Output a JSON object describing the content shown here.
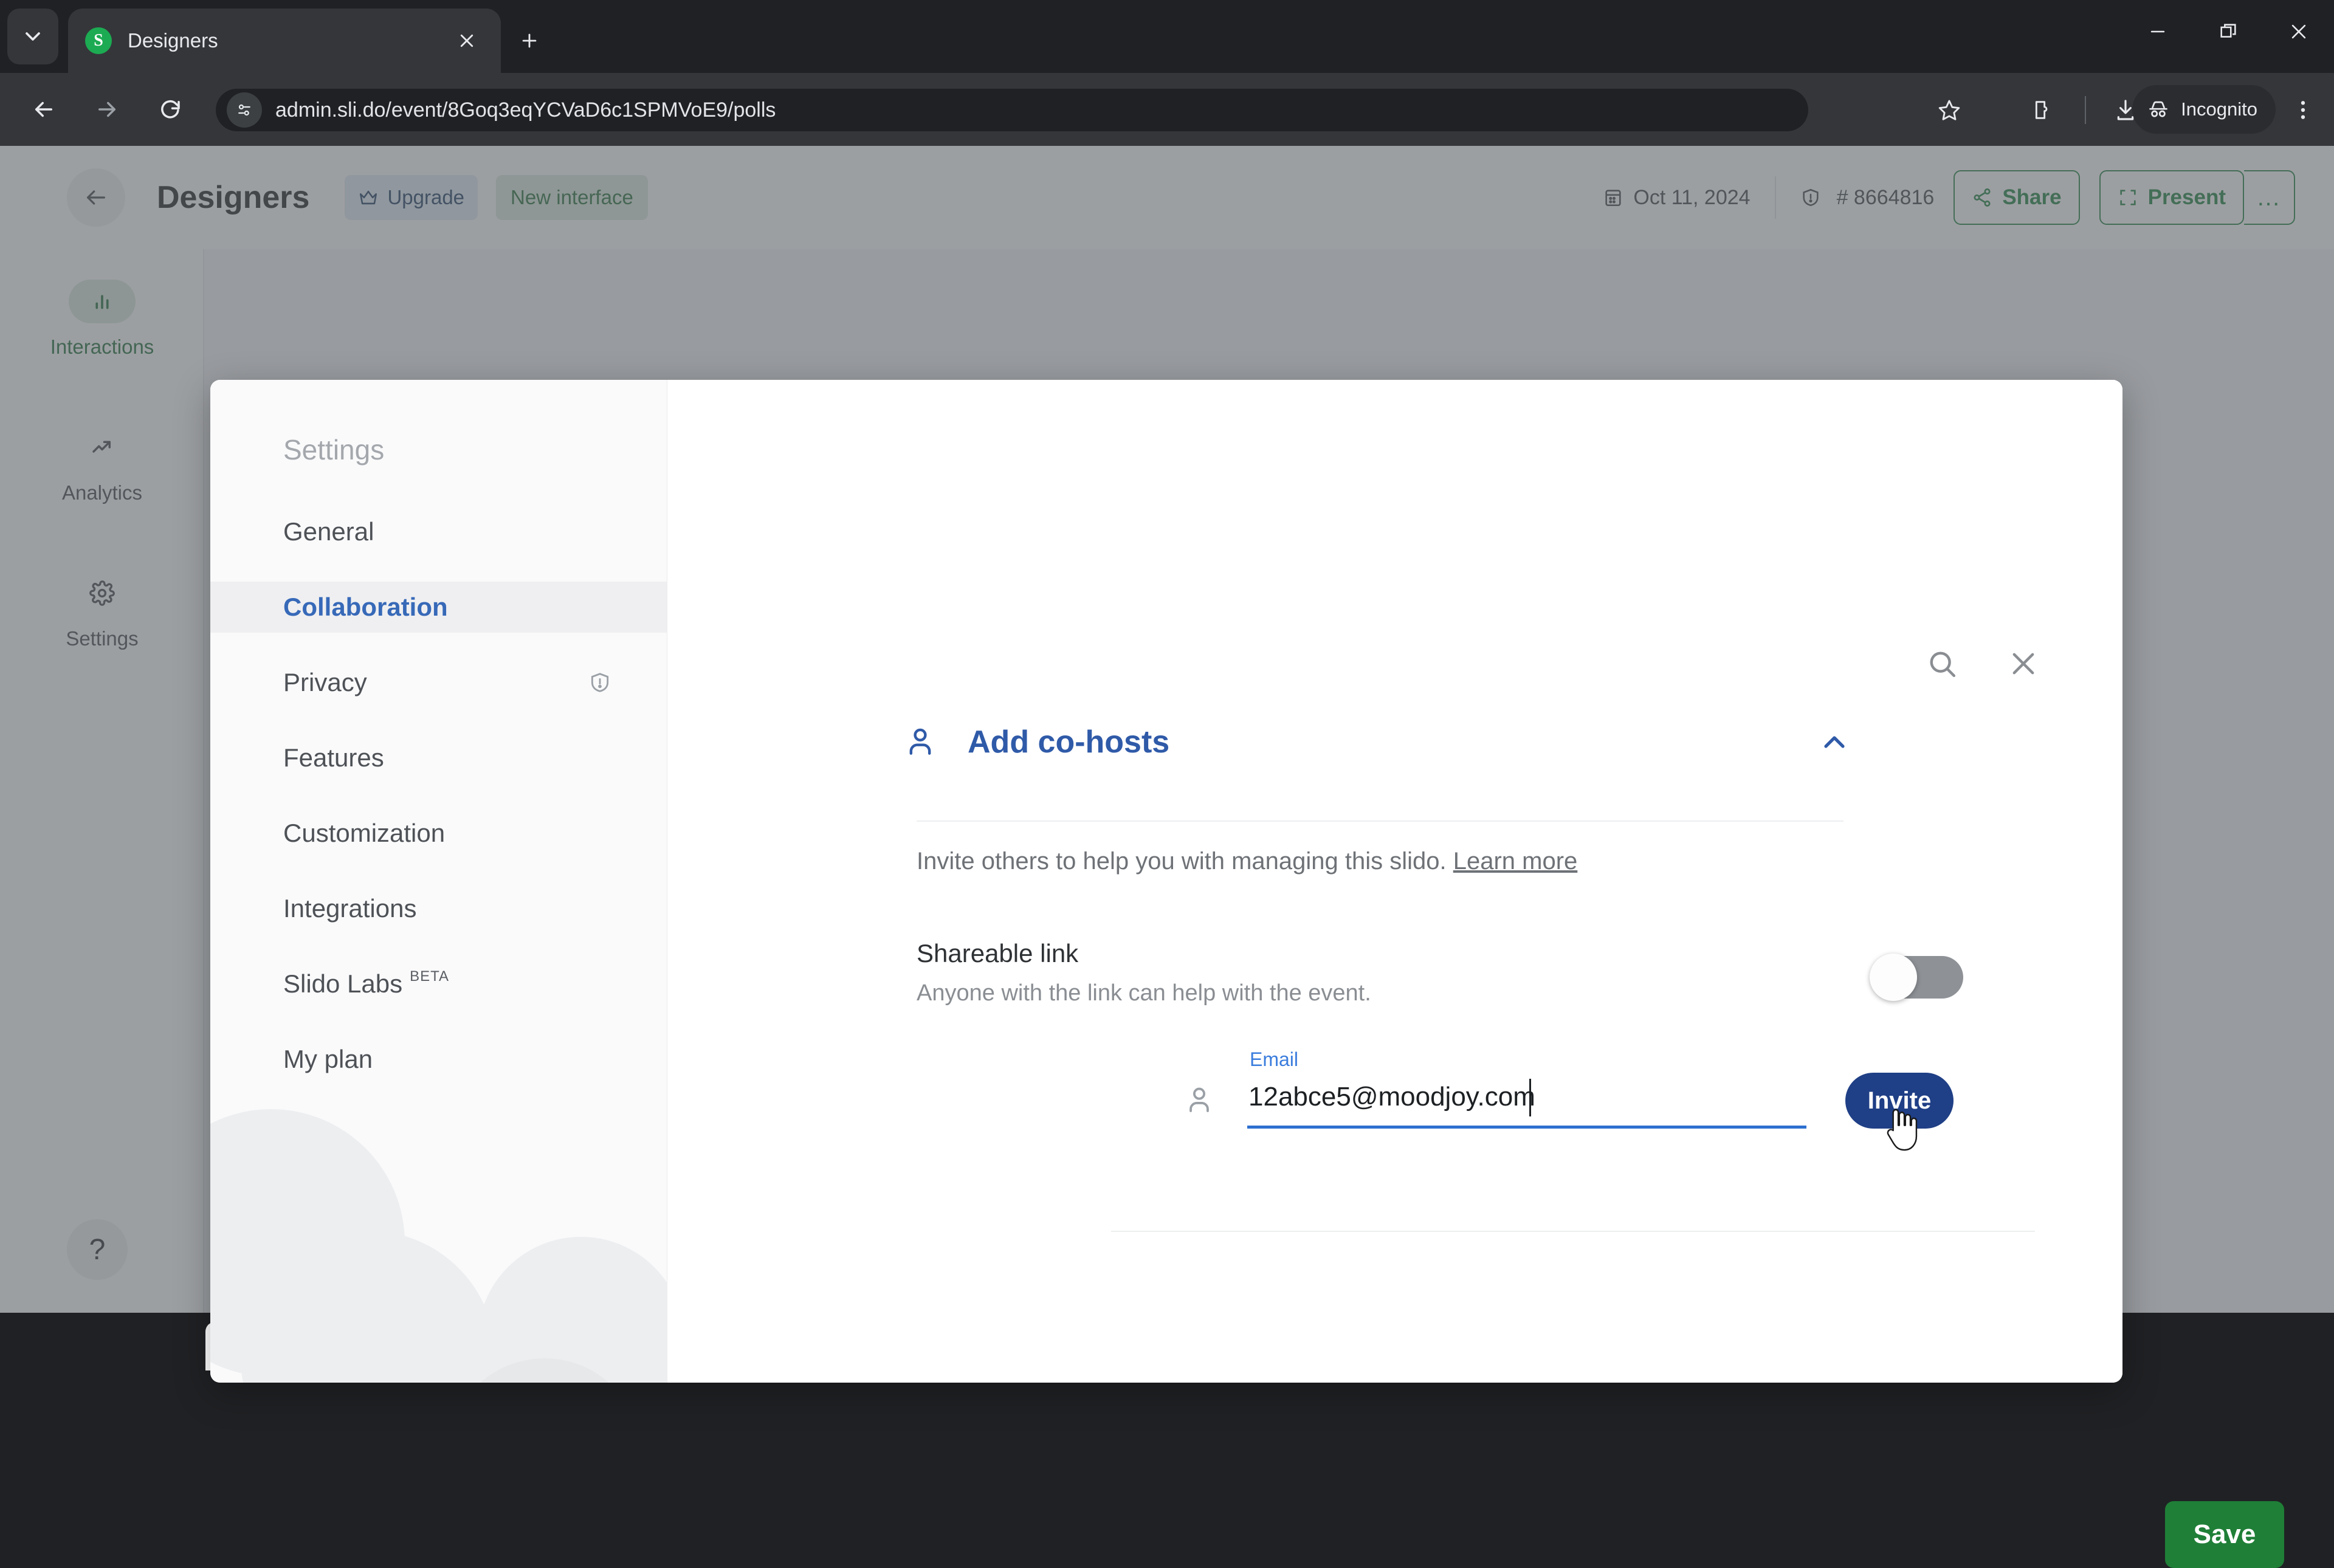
{
  "browser": {
    "tab": {
      "title": "Designers",
      "favicon_letter": "S",
      "favicon_color": "#1cab52"
    },
    "tab_search_icon": "chevron-down-icon",
    "new_tab_icon": "plus-icon",
    "window_controls": [
      "minimize-icon",
      "restore-icon",
      "close-icon"
    ],
    "nav": {
      "back_icon": "arrow-left-icon",
      "forward_icon": "arrow-right-icon",
      "reload_icon": "reload-icon"
    },
    "omnibox": {
      "site_info_icon": "page-settings-icon",
      "url": "admin.sli.do/event/8Goq3eqYCVaD6c1SPMVoE9/polls"
    },
    "actions": {
      "bookmark_icon": "star-icon",
      "extensions_icon": "extensions-icon",
      "download_icon": "download-icon",
      "incognito_icon": "incognito-icon",
      "incognito_label": "Incognito",
      "menu_icon": "kebab-menu-icon"
    }
  },
  "app_header": {
    "back_icon": "arrow-left-icon",
    "title": "Designers",
    "upgrade": {
      "icon": "crown-icon",
      "label": "Upgrade"
    },
    "new_interface_label": "New interface",
    "date": {
      "icon": "calendar-icon",
      "label": "Oct 11, 2024"
    },
    "event_code": {
      "icon": "shield-alert-icon",
      "label": "# 8664816"
    },
    "share": {
      "icon": "share-icon",
      "label": "Share"
    },
    "present": {
      "icon": "present-icon",
      "label": "Present"
    },
    "more_label": "…"
  },
  "left_rail": {
    "items": [
      {
        "icon": "bar-chart-icon",
        "label": "Interactions",
        "active": true
      },
      {
        "icon": "trending-up-icon",
        "label": "Analytics",
        "active": false
      },
      {
        "icon": "gear-icon",
        "label": "Settings",
        "active": false
      }
    ],
    "help_label": "?"
  },
  "modal": {
    "sidebar": {
      "heading": "Settings",
      "items": [
        {
          "label": "General",
          "active": false,
          "badge": "",
          "warn": false
        },
        {
          "label": "Collaboration",
          "active": true,
          "badge": "",
          "warn": false
        },
        {
          "label": "Privacy",
          "active": false,
          "badge": "",
          "warn": true
        },
        {
          "label": "Features",
          "active": false,
          "badge": "",
          "warn": false
        },
        {
          "label": "Customization",
          "active": false,
          "badge": "",
          "warn": false
        },
        {
          "label": "Integrations",
          "active": false,
          "badge": "",
          "warn": false
        },
        {
          "label": "Slido Labs",
          "active": false,
          "badge": "BETA",
          "warn": false
        },
        {
          "label": "My plan",
          "active": false,
          "badge": "",
          "warn": false
        }
      ]
    },
    "search_icon": "search-icon",
    "close_icon": "close-icon",
    "section": {
      "icon": "person-add-icon",
      "title": "Add co-hosts",
      "chevron_icon": "chevron-up-icon",
      "description": "Invite others to help you with managing this slido.",
      "learn_more": "Learn more"
    },
    "shareable_link": {
      "title": "Shareable link",
      "subtitle": "Anyone with the link can help with the event.",
      "toggle_state": "off"
    },
    "email_field": {
      "icon": "person-icon",
      "label": "Email",
      "value": "12abce5@moodjoy.com",
      "placeholder": "Email"
    },
    "invite_button": "Invite",
    "save_button": "Save",
    "accent_blue": "#2f5aa8",
    "accent_green": "#1f7f37",
    "invite_blue": "#1f3f86"
  }
}
